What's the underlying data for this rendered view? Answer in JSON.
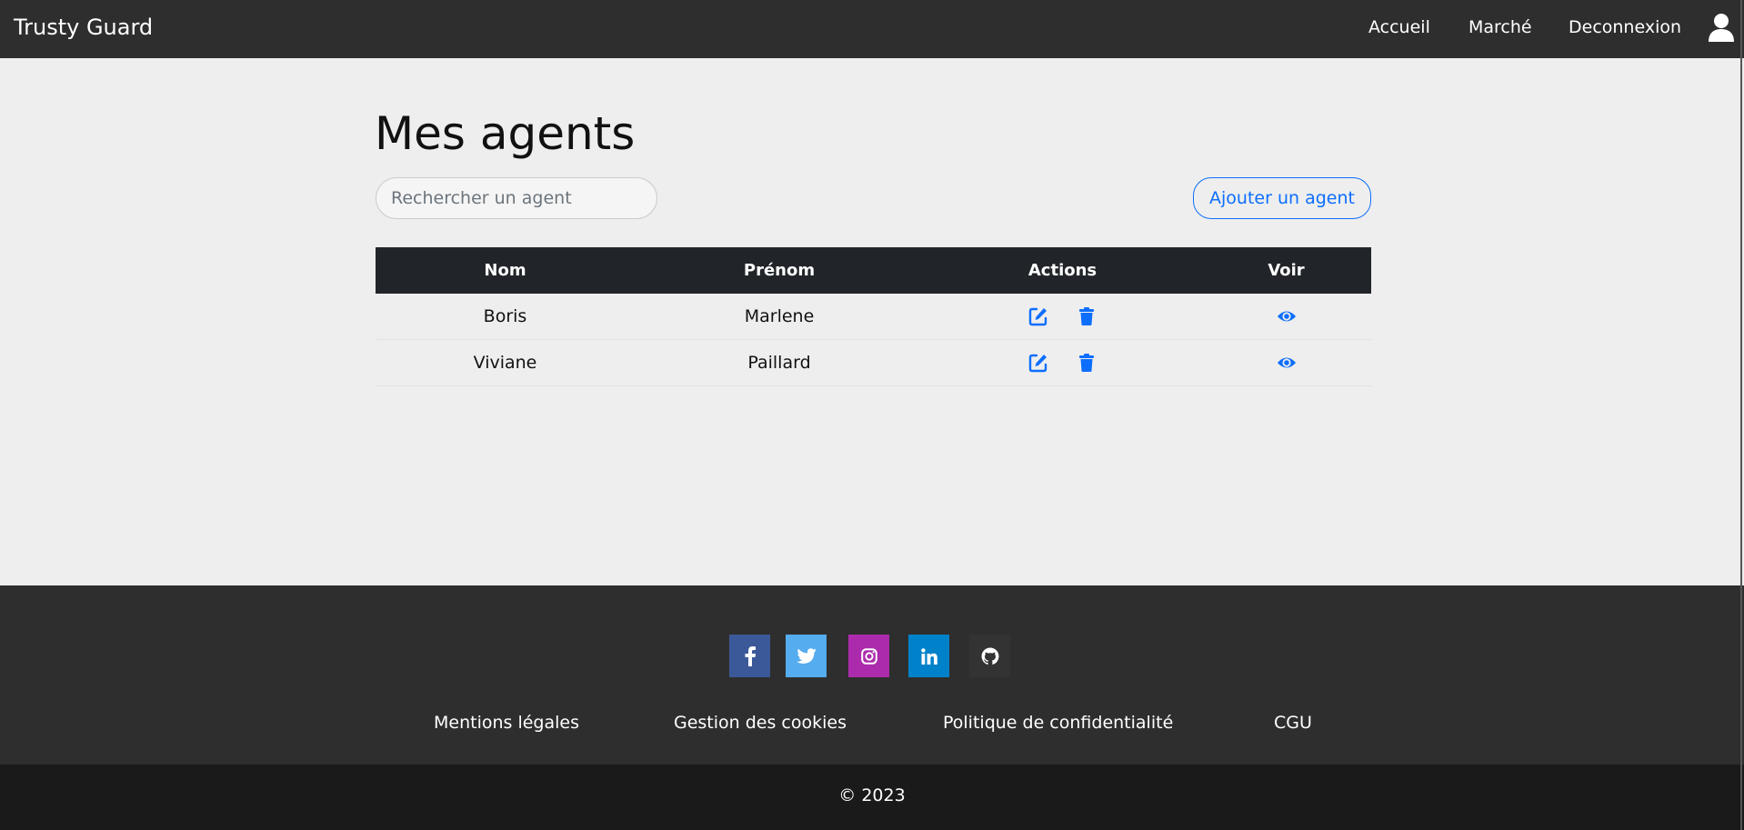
{
  "navbar": {
    "brand": "Trusty Guard",
    "links": [
      "Accueil",
      "Marché",
      "Deconnexion"
    ]
  },
  "main": {
    "title": "Mes agents",
    "search_placeholder": "Rechercher un agent",
    "add_button": "Ajouter un agent",
    "table": {
      "headers": [
        "Nom",
        "Prénom",
        "Actions",
        "Voir"
      ],
      "rows": [
        {
          "nom": "Boris",
          "prenom": "Marlene"
        },
        {
          "nom": "Viviane",
          "prenom": "Paillard"
        }
      ]
    }
  },
  "footer": {
    "social": [
      {
        "icon": "facebook-icon",
        "color": "#3b5998"
      },
      {
        "icon": "twitter-icon",
        "color": "#55acee"
      },
      {
        "icon": "instagram-icon",
        "color": "#ac2bac"
      },
      {
        "icon": "linkedin-icon",
        "color": "#0082ca"
      },
      {
        "icon": "github-icon",
        "color": "#333333"
      }
    ],
    "links": [
      "Mentions légales",
      "Gestion des cookies",
      "Politique de confidentialité",
      "CGU"
    ],
    "copyright": "© 2023"
  },
  "colors": {
    "primary": "#0d6efd",
    "navbar_bg": "#2e2e2e",
    "table_header_bg": "#212529",
    "page_bg": "#eeeeee"
  }
}
